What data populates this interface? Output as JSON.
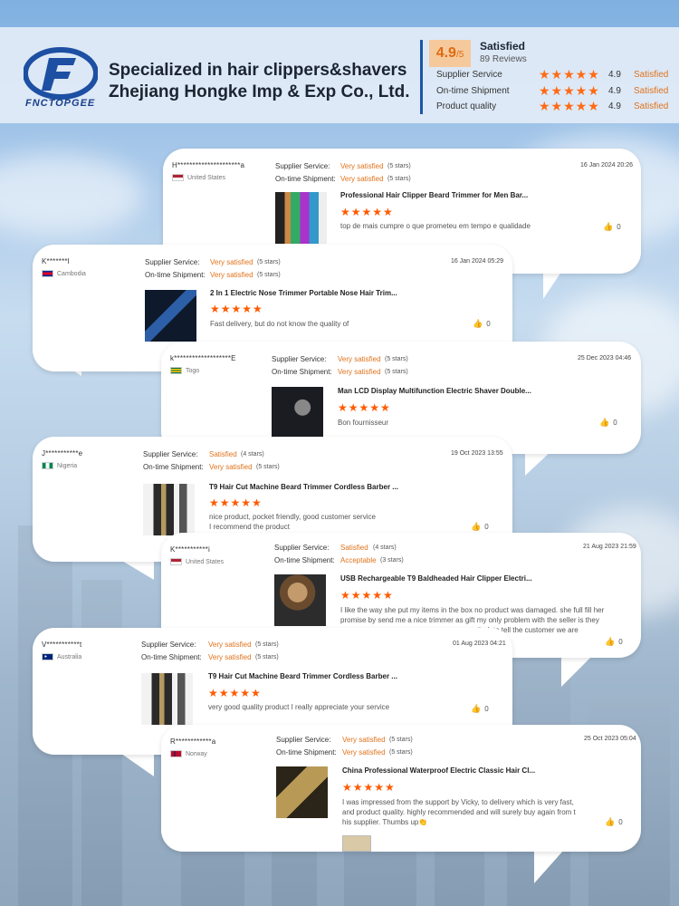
{
  "header": {
    "logo_text": "FNCTOPGEE",
    "company_line1": "Specialized in hair clippers&shavers",
    "company_line2": "Zhejiang Hongke Imp & Exp Co., Ltd.",
    "score": "4.9",
    "score_suffix": "/5",
    "score_label": "Satisfied",
    "reviews_count": "89 Reviews",
    "metrics": [
      {
        "label": "Supplier Service",
        "stars": "★★★★★",
        "score": "4.9",
        "status": "Satisfied"
      },
      {
        "label": "On-time Shipment",
        "stars": "★★★★★",
        "score": "4.9",
        "status": "Satisfied"
      },
      {
        "label": "Product quality",
        "stars": "★★★★★",
        "score": "4.9",
        "status": "Satisfied"
      }
    ]
  },
  "labels": {
    "supplier_service": "Supplier Service:",
    "ontime_shipment": "On-time Shipment:"
  },
  "reviews": [
    {
      "user": "H*********************a",
      "country": "United States",
      "service": "Very satisfied",
      "service_note": "(5 stars)",
      "shipment": "Very satisfied",
      "shipment_note": "(5 stars)",
      "date": "16 Jan 2024 20:26",
      "product": "Professional Hair Clipper Beard Trimmer for Men Bar...",
      "stars": "★★★★★",
      "comment": "top de mais cumpre o que prometeu em tempo e qualidade",
      "likes": "0"
    },
    {
      "user": "K*******l",
      "country": "Cambodia",
      "service": "Very satisfied",
      "service_note": "(5 stars)",
      "shipment": "Very satisfied",
      "shipment_note": "(5 stars)",
      "date": "16 Jan 2024 05:29",
      "product": "2 In 1 Electric Nose Trimmer Portable Nose Hair Trim...",
      "stars": "★★★★★",
      "comment": "Fast delivery, but do not know the quality of",
      "likes": "0"
    },
    {
      "user": "k*******************E",
      "country": "Togo",
      "service": "Very satisfied",
      "service_note": "(5 stars)",
      "shipment": "Very satisfied",
      "shipment_note": "(5 stars)",
      "date": "25 Dec 2023 04:46",
      "product": "Man LCD Display Multifunction Electric Shaver Double...",
      "stars": "★★★★★",
      "comment": "Bon fournisseur",
      "likes": "0"
    },
    {
      "user": "J***********e",
      "country": "Nigeria",
      "service": "Satisfied",
      "service_note": "(4 stars)",
      "shipment": "Very satisfied",
      "shipment_note": "(5 stars)",
      "date": "19 Oct 2023 13:55",
      "product": "T9 Hair Cut Machine Beard Trimmer Cordless Barber ...",
      "stars": "★★★★★",
      "comment": "nice product, pocket friendly, good customer service\nI recommend the product",
      "likes": "0"
    },
    {
      "user": "K***********i",
      "country": "United States",
      "service": "Satisfied",
      "service_note": "(4 stars)",
      "shipment": "Acceptable",
      "shipment_note": "(3 stars)",
      "date": "21 Aug 2023 21:59",
      "product": "USB Rechargeable T9 Baldheaded Hair Clipper Electri...",
      "stars": "★★★★★",
      "comment": "I like the way she put my items in the box no product was damaged. she full fill her promise by send me a nice trimmer as gift my only problem with the seller is they pr",
      "comment_tail": "it ok to tell the customer we are",
      "likes": "0"
    },
    {
      "user": "V***********t",
      "country": "Australia",
      "service": "Very satisfied",
      "service_note": "(5 stars)",
      "shipment": "Very satisfied",
      "shipment_note": "(5 stars)",
      "date": "01 Aug 2023 04:21",
      "product": "T9 Hair Cut Machine Beard Trimmer Cordless Barber ...",
      "stars": "★★★★★",
      "comment": "very good quality product I really appreciate your service",
      "likes": "0"
    },
    {
      "user": "R************a",
      "country": "Norway",
      "service": "Very satisfied",
      "service_note": "(5 stars)",
      "shipment": "Very satisfied",
      "shipment_note": "(5 stars)",
      "date": "25 Oct 2023 05:04",
      "product": "China Professional Waterproof Electric Classic Hair Cl...",
      "stars": "★★★★★",
      "comment": "I was impressed from the support by Vicky, to delivery which is very fast, and product quality. highly recommended and will surely buy again from t his supplier. Thumbs up👏",
      "likes": "0"
    }
  ]
}
